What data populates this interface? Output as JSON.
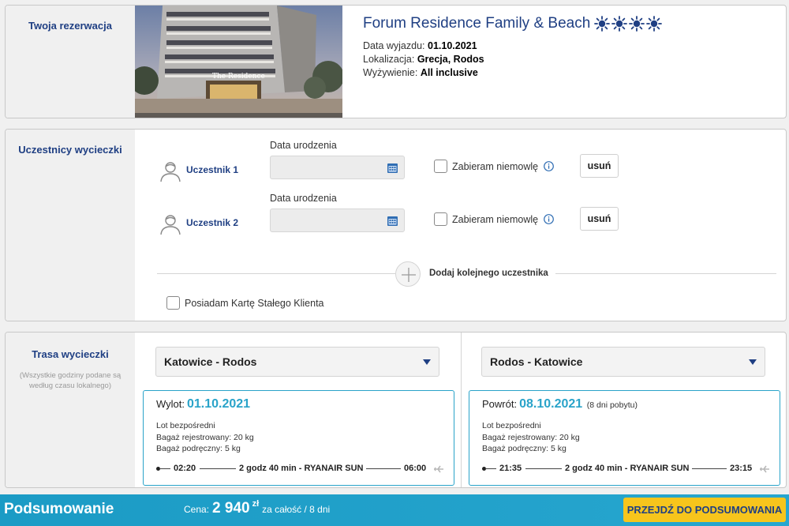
{
  "reservation": {
    "title": "Twoja rezerwacja",
    "hotel_name": "Forum Residence Family & Beach",
    "stars": 4,
    "departure_label": "Data wyjazdu:",
    "departure_value": "01.10.2021",
    "location_label": "Lokalizacja:",
    "location_value": "Grecja, Rodos",
    "board_label": "Wyżywienie:",
    "board_value": "All inclusive",
    "image_sign": "The Residence"
  },
  "participants": {
    "title": "Uczestnicy wycieczki",
    "items": [
      {
        "name": "Uczestnik 1",
        "dob_label": "Data urodzenia",
        "dob_value": "",
        "infant_label": "Zabieram niemowlę",
        "remove_label": "usuń"
      },
      {
        "name": "Uczestnik 2",
        "dob_label": "Data urodzenia",
        "dob_value": "",
        "infant_label": "Zabieram niemowlę",
        "remove_label": "usuń"
      }
    ],
    "add_label": "Dodaj kolejnego uczestnika",
    "loyalty_label": "Posiadam Kartę Stałego Klienta"
  },
  "route": {
    "title": "Trasa wycieczki",
    "timezone_note": "(Wszystkie godziny podane są według czasu lokalnego)",
    "outbound": {
      "select_value": "Katowice - Rodos",
      "head_label": "Wylot:",
      "date": "01.10.2021",
      "note": "",
      "direct": "Lot bezpośredni",
      "checked_baggage": "Bagaż rejestrowany: 20 kg",
      "hand_baggage": "Bagaż podręczny: 5 kg",
      "dep_time": "02:20",
      "duration_carrier": "2 godz 40 min  -  RYANAIR SUN",
      "arr_time": "06:00"
    },
    "inbound": {
      "select_value": "Rodos - Katowice",
      "head_label": "Powrót:",
      "date": "08.10.2021",
      "note": "(8 dni pobytu)",
      "direct": "Lot bezpośredni",
      "checked_baggage": "Bagaż rejestrowany: 20 kg",
      "hand_baggage": "Bagaż podręczny: 5 kg",
      "dep_time": "21:35",
      "duration_carrier": "2 godz 40 min  -  RYANAIR SUN",
      "arr_time": "23:15"
    }
  },
  "summary": {
    "title": "Podsumowanie",
    "price_label": "Cena:",
    "price_value": "2 940",
    "currency": "zł",
    "price_note": "za całość / 8 dni",
    "cta_label": "PRZEJDŹ DO PODSUMOWANIA"
  },
  "colors": {
    "brand": "#1f3f83",
    "accent": "#29a3c9",
    "cta": "#f7c51c"
  }
}
